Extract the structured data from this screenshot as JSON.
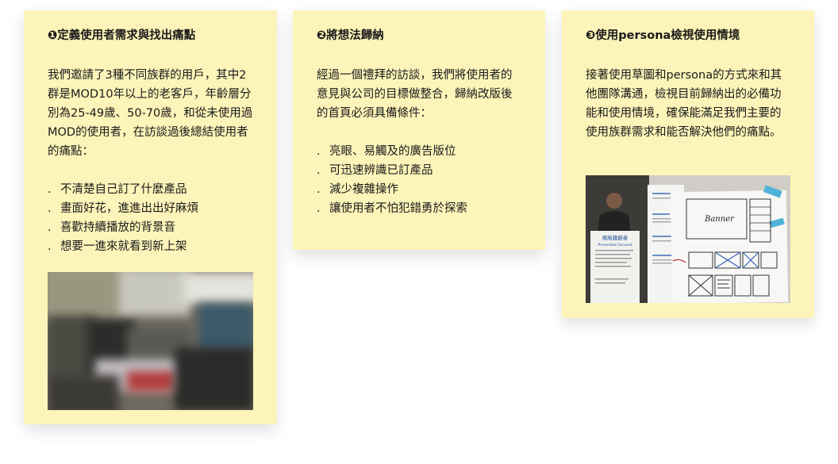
{
  "cards": [
    {
      "title": "❶定義使用者需求與找出痛點",
      "body": "我們邀請了3種不同族群的用戶，其中2群是MOD10年以上的老客戶，年齡層分別為25-49歲、50-70歲，和從未使用過MOD的使用者，在訪談過後總結使用者的痛點：",
      "bullets": [
        "不清楚自己訂了什麼產品",
        "畫面好花，進進出出好麻煩",
        "喜歡持續播放的背景音",
        "想要一進來就看到新上架"
      ]
    },
    {
      "title": "❷將想法歸納",
      "body": "經過一個禮拜的訪談，我們將使用者的意見與公司的目標做整合，歸納改版後的首頁必須具備條件：",
      "bullets": [
        "亮眼、易觸及的廣告版位",
        "可迅速辨識已訂產品",
        "減少複雜操作",
        "讓使用者不怕犯錯勇於探索"
      ]
    },
    {
      "title": "❸使用persona檢視使用情境",
      "body": "接著使用草圖和persona的方式來和其他團隊溝通，檢視目前歸納出的必備功能和使用情境，確保能滿足我們主要的使用族群需求和能否解決他們的痛點。",
      "bullets": []
    }
  ],
  "bullet_marker": ".",
  "photo_text": {
    "poster_title": "風險趨避者",
    "poster_subtitle": "Prevention focused",
    "sketch_word": "Banner"
  },
  "colors": {
    "card_background": "#fdf4b9",
    "text": "#1a1a1a"
  }
}
